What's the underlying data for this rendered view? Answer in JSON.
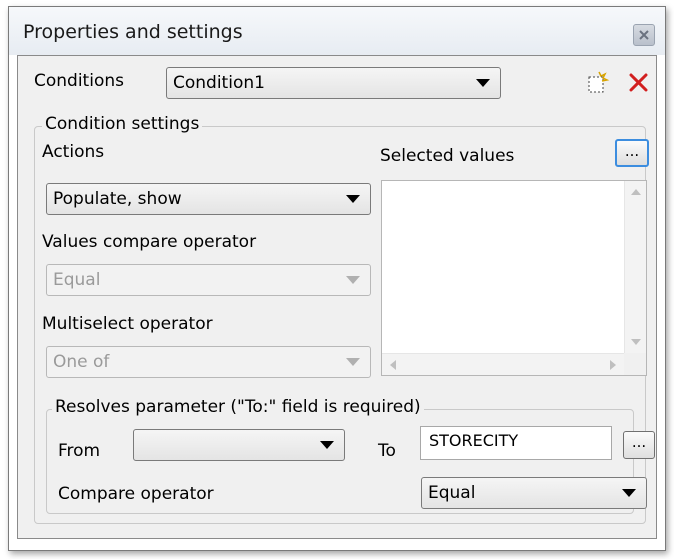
{
  "window": {
    "title": "Properties and settings"
  },
  "conditions": {
    "label": "Conditions",
    "selected": "Condition1"
  },
  "condition_settings": {
    "legend": "Condition settings",
    "actions_label": "Actions",
    "actions_value": "Populate, show",
    "values_compare_label": "Values compare operator",
    "values_compare_value": "Equal",
    "multiselect_label": "Multiselect operator",
    "multiselect_value": "One of",
    "selected_values_label": "Selected values",
    "selected_values_button": "..."
  },
  "resolves": {
    "legend": "Resolves parameter (\"To:\" field is required)",
    "from_label": "From",
    "from_value": "",
    "to_label": "To",
    "to_value": "STORECITY",
    "to_button": "...",
    "compare_label": "Compare operator",
    "compare_value": "Equal"
  },
  "icons": {
    "new": "new-document-icon",
    "delete": "delete-x-icon",
    "close": "window-close-icon"
  },
  "colors": {
    "delete_red": "#d21f1f",
    "focus_blue": "#3c8ddf",
    "dialog_bg": "#f0f0f0"
  }
}
